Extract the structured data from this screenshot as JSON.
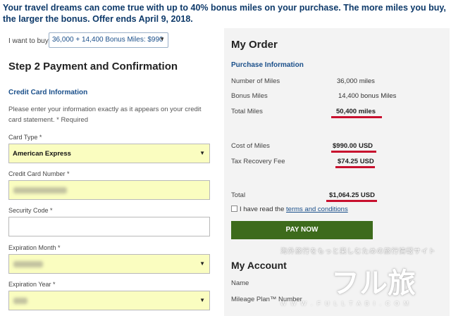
{
  "banner": {
    "text": "Your travel dreams can come true with up to 40% bonus miles on your purchase. The more miles you buy, the larger the bonus. Offer ends April 9, 2018."
  },
  "purchase": {
    "want_label": "I want to buy",
    "selected_option": "36,000 + 14,400 Bonus Miles: $990",
    "step_title": "Step 2 Payment and Confirmation",
    "cc_heading": "Credit Card Information",
    "instructions": "Please enter your information exactly as it appears on your credit card statement. * Required"
  },
  "form": {
    "card_type_label": "Card Type *",
    "card_type_value": "American Express",
    "card_number_label": "Credit Card Number *",
    "security_code_label": "Security Code *",
    "exp_month_label": "Expiration Month *",
    "exp_year_label": "Expiration Year *"
  },
  "order": {
    "title": "My Order",
    "section_heading": "Purchase Information",
    "rows": [
      {
        "label": "Number of Miles",
        "value": "36,000 miles"
      },
      {
        "label": "Bonus Miles",
        "value": "14,400 bonus Miles"
      },
      {
        "label": "Total Miles",
        "value": "50,400 miles"
      },
      {
        "label": "Cost of Miles",
        "value": "$990.00 USD"
      },
      {
        "label": "Tax Recovery Fee",
        "value": "$74.25 USD"
      },
      {
        "label": "Total",
        "value": "$1,064.25 USD"
      }
    ],
    "agree_prefix": "I have read the ",
    "terms_link": "terms and conditions",
    "pay_button": "PAY NOW",
    "highlight_color": "#c8102e",
    "button_color": "#3d6b1c"
  },
  "account": {
    "title": "My Account",
    "name_label": "Name",
    "mileage_label": "Mileage Plan™ Number"
  },
  "watermark": {
    "tagline": "海外旅行をもっと楽しむための旅行情報サイト",
    "logo": "フル旅",
    "url": "W W W . F U L L T A B I . C O M"
  }
}
